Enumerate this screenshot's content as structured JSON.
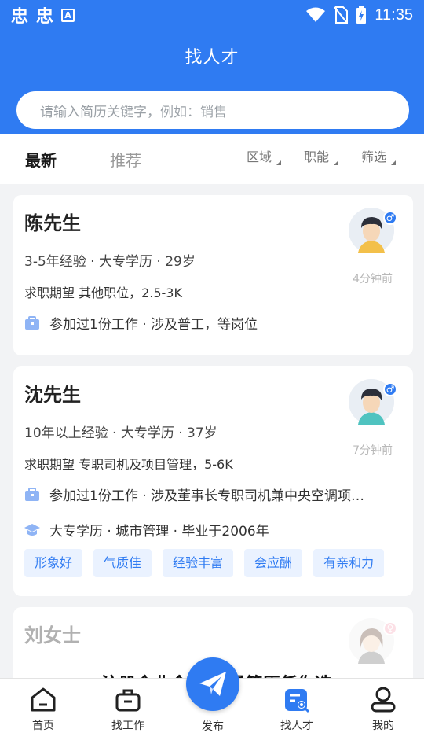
{
  "status_bar": {
    "glyphs": [
      "忠",
      "忠"
    ],
    "badge": "A",
    "time": "11:35"
  },
  "header": {
    "title": "找人才"
  },
  "search": {
    "placeholder": "请输入简历关键字，例如：销售"
  },
  "tabs": {
    "latest": "最新",
    "recommend": "推荐"
  },
  "filters": {
    "region": "区域",
    "position": "职能",
    "filter": "筛选"
  },
  "cards": [
    {
      "name": "陈先生",
      "meta": "3-5年经验 · 大专学历 · 29岁",
      "expect": "求职期望 其他职位，2.5-3K",
      "work": "参加过1份工作 · 涉及普工，等岗位",
      "time": "4分钟前",
      "gender": "♂"
    },
    {
      "name": "沈先生",
      "meta": "10年以上经验 · 大专学历 · 37岁",
      "expect": "求职期望 专职司机及项目管理，5-6K",
      "work": "参加过1份工作 · 涉及董事长专职司机兼中央空调项…",
      "edu": "大专学历 · 城市管理 · 毕业于2006年",
      "time": "7分钟前",
      "gender": "♂",
      "tags": [
        "形象好",
        "气质佳",
        "经验丰富",
        "会应酬",
        "有亲和力"
      ]
    },
    {
      "name": "刘女士",
      "promo": "注册企业会员 海量简历任你选"
    }
  ],
  "tabbar": {
    "home": "首页",
    "jobs": "找工作",
    "publish": "发布",
    "talent": "找人才",
    "mine": "我的"
  },
  "colors": {
    "primary": "#2f7bf2",
    "tag_bg": "#eaf2ff"
  }
}
